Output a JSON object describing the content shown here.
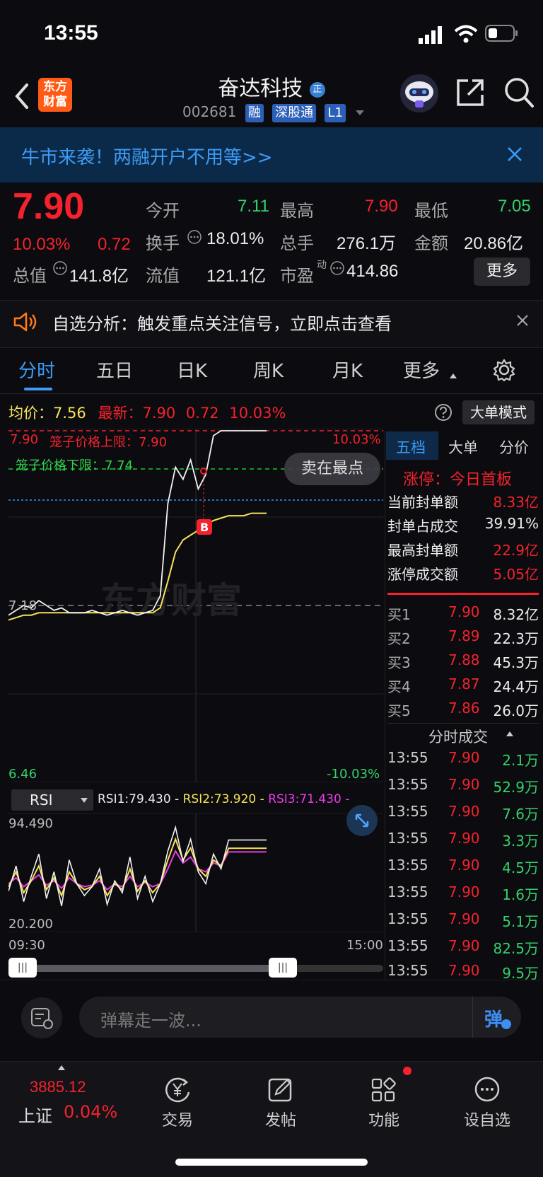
{
  "status_bar": {
    "time": "13:55"
  },
  "header": {
    "logo_text": "东方财富",
    "title": "奋达科技",
    "title_badge": "正",
    "code": "002681",
    "tags": [
      "融",
      "深股通",
      "L1"
    ]
  },
  "banner": {
    "text": "牛市来袭！两融开户不用等>>"
  },
  "quote": {
    "price": "7.90",
    "change_pct": "10.03%",
    "change": "0.72",
    "open_label": "今开",
    "open": "7.11",
    "high_label": "最高",
    "high": "7.90",
    "low_label": "最低",
    "low": "7.05",
    "turnover_label": "换手",
    "turnover": "18.01%",
    "volume_label": "总手",
    "volume": "276.1万",
    "amount_label": "金额",
    "amount": "20.86亿",
    "mktcap_label": "总值",
    "mktcap": "141.8亿",
    "float_label": "流值",
    "float": "121.1亿",
    "pe_label": "市盈",
    "pe_sup": "动",
    "pe": "414.86",
    "more_button": "更多"
  },
  "notice": {
    "text": "自选分析：触发重点关注信号，立即点击查看"
  },
  "tabs": [
    "分时",
    "五日",
    "日K",
    "周K",
    "月K",
    "更多"
  ],
  "chart_info": {
    "avg_label": "均价：",
    "avg": "7.56",
    "latest_label": "最新：",
    "latest": "7.90",
    "latest_chg": "0.72",
    "latest_pct": "10.03%",
    "big_order_mode": "大单模式"
  },
  "chart_labels": {
    "upper_price": "7.90",
    "upper_cage": "笼子价格上限：7.90",
    "upper_pct": "10.03%",
    "lower_cage": "笼子价格下限：7.74",
    "sell_at_top": "卖在最点",
    "prev_close": "7.18",
    "lower_price": "6.46",
    "lower_pct": "-10.03%",
    "watermark": "东方财富",
    "buy_marker": "B"
  },
  "rsi": {
    "selector": "RSI",
    "rsi1": "RSI1:79.430 -",
    "rsi2": "RSI2:73.920 -",
    "rsi3": "RSI3:71.430 -",
    "top": "94.490",
    "bottom": "20.200",
    "start_time": "09:30",
    "end_time": "15:00"
  },
  "right_panel": {
    "tabs": [
      "五档",
      "大单",
      "分价"
    ],
    "limit_title": "涨停：今日首板",
    "rows": [
      {
        "label": "当前封单额",
        "value": "8.33亿"
      },
      {
        "label": "封单占成交",
        "value": "39.91%"
      },
      {
        "label": "最高封单额",
        "value": "22.9亿"
      },
      {
        "label": "涨停成交额",
        "value": "5.05亿"
      }
    ],
    "bids": [
      {
        "label": "买1",
        "price": "7.90",
        "vol": "8.32亿"
      },
      {
        "label": "买2",
        "price": "7.89",
        "vol": "22.3万"
      },
      {
        "label": "买3",
        "price": "7.88",
        "vol": "45.3万"
      },
      {
        "label": "买4",
        "price": "7.87",
        "vol": "24.4万"
      },
      {
        "label": "买5",
        "price": "7.86",
        "vol": "26.0万"
      }
    ],
    "trades_title": "分时成交",
    "trades": [
      {
        "time": "13:55",
        "price": "7.90",
        "vol": "2.1万"
      },
      {
        "time": "13:55",
        "price": "7.90",
        "vol": "52.9万"
      },
      {
        "time": "13:55",
        "price": "7.90",
        "vol": "7.6万"
      },
      {
        "time": "13:55",
        "price": "7.90",
        "vol": "3.3万"
      },
      {
        "time": "13:55",
        "price": "7.90",
        "vol": "4.5万"
      },
      {
        "time": "13:55",
        "price": "7.90",
        "vol": "1.6万"
      },
      {
        "time": "13:55",
        "price": "7.90",
        "vol": "5.1万"
      },
      {
        "time": "13:55",
        "price": "7.90",
        "vol": "82.5万"
      },
      {
        "time": "13:55",
        "price": "7.90",
        "vol": "9.5万"
      }
    ]
  },
  "input_bar": {
    "placeholder": "弹幕走一波...",
    "send_icon_text": "弹"
  },
  "bottom_nav": {
    "index_value": "3885.12",
    "index_name": "上证",
    "index_pct": "0.04%",
    "items": [
      "交易",
      "发帖",
      "功能",
      "设自选"
    ]
  },
  "chart_data": [
    {
      "type": "line",
      "title": "",
      "ylim": [
        6.46,
        7.9
      ],
      "series": [
        {
          "values": [
            7.14,
            7.16,
            7.18,
            7.17,
            7.2,
            7.18,
            7.16,
            7.17,
            7.15,
            7.15,
            7.15,
            7.16,
            7.15,
            7.14,
            7.15,
            7.16,
            7.15,
            7.14,
            7.15,
            7.16,
            7.22,
            7.6,
            7.75,
            7.7,
            7.78,
            7.66,
            7.72,
            7.88,
            7.9,
            7.9,
            7.9,
            7.9,
            7.9,
            7.9,
            7.9
          ]
        },
        {
          "values": [
            7.12,
            7.13,
            7.14,
            7.14,
            7.15,
            7.15,
            7.15,
            7.15,
            7.15,
            7.15,
            7.15,
            7.15,
            7.15,
            7.15,
            7.15,
            7.15,
            7.15,
            7.15,
            7.15,
            7.15,
            7.17,
            7.28,
            7.4,
            7.45,
            7.47,
            7.49,
            7.51,
            7.53,
            7.54,
            7.55,
            7.55,
            7.55,
            7.56,
            7.56,
            7.56
          ]
        }
      ]
    },
    {
      "type": "line",
      "title": "",
      "ylim": [
        20.2,
        94.49
      ],
      "series": [
        {
          "name": "RSI1",
          "values": [
            45,
            62,
            38,
            55,
            70,
            40,
            58,
            35,
            66,
            50,
            42,
            48,
            60,
            36,
            52,
            44,
            68,
            40,
            55,
            38,
            50,
            72,
            88,
            65,
            80,
            58,
            50,
            70,
            60,
            79.43,
            79.43,
            79.43,
            79.43,
            79.43,
            79.43
          ]
        },
        {
          "name": "RSI2",
          "values": [
            48,
            58,
            44,
            52,
            62,
            46,
            54,
            42,
            58,
            50,
            46,
            48,
            55,
            42,
            50,
            46,
            60,
            45,
            52,
            44,
            50,
            66,
            80,
            66,
            74,
            60,
            55,
            66,
            62,
            73.92,
            73.92,
            73.92,
            73.92,
            73.92,
            73.92
          ]
        },
        {
          "name": "RSI3",
          "values": [
            50,
            54,
            48,
            52,
            56,
            49,
            52,
            47,
            54,
            50,
            48,
            49,
            52,
            46,
            50,
            48,
            55,
            48,
            51,
            48,
            50,
            60,
            72,
            64,
            68,
            60,
            58,
            64,
            62,
            71.43,
            71.43,
            71.43,
            71.43,
            71.43,
            71.43
          ]
        }
      ]
    }
  ]
}
